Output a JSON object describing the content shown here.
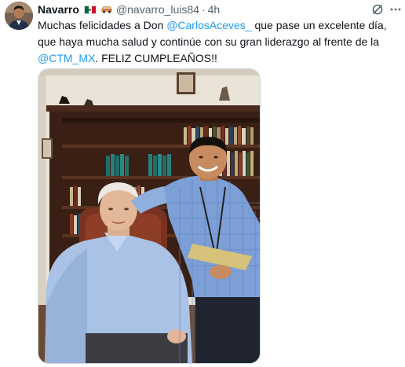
{
  "tweet": {
    "display_name": "Navarro",
    "flag_emoji": "🇲🇽",
    "extra_emoji": "🚗",
    "handle": "@navarro_luis84",
    "separator": "·",
    "time": "4h",
    "text": {
      "t1": "Muchas felicidades a Don ",
      "m1": "@CarlosAceves_",
      "t2": " que pase un excelente día, que haya mucha salud y continúe con su gran liderazgo al frente de la ",
      "m2": "@CTM_MX",
      "t3": ". FELIZ CUMPLEAÑOS!!"
    },
    "icons": {
      "grok": "grok-icon",
      "more": "more-horizontal-icon"
    },
    "colors": {
      "text": "#0f1419",
      "secondary": "#536471",
      "link": "#1d9bf0"
    }
  }
}
